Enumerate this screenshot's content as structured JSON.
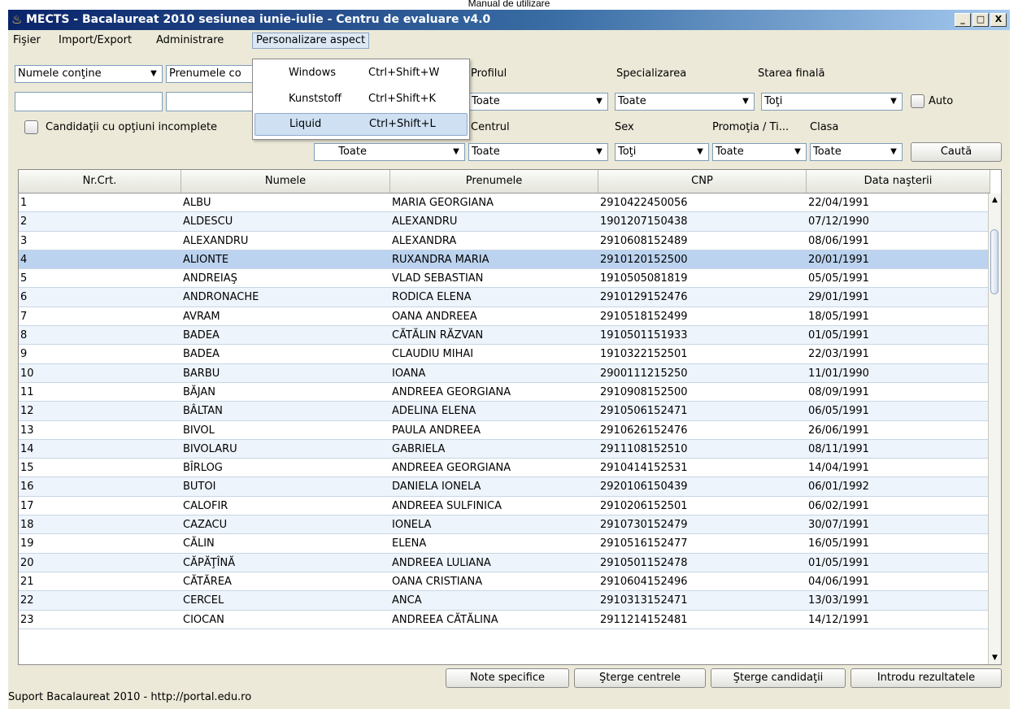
{
  "page_caption": "Manual de utilizare",
  "window": {
    "title": "MECTS - Bacalaureat 2010 sesiunea iunie-iulie - Centru de evaluare v4.0",
    "minimize": "_",
    "maximize": "□",
    "close": "X"
  },
  "menu": {
    "items": [
      {
        "label": "Fişier"
      },
      {
        "label": "Import/Export"
      },
      {
        "label": "Administrare"
      },
      {
        "label": "Personalizare aspect"
      }
    ],
    "popup": [
      {
        "label": "Windows",
        "shortcut": "Ctrl+Shift+W"
      },
      {
        "label": "Kunststoff",
        "shortcut": "Ctrl+Shift+K"
      },
      {
        "label": "Liquid",
        "shortcut": "Ctrl+Shift+L"
      }
    ]
  },
  "filters": {
    "name_mode": "Numele conţine",
    "firstname_mode": "Prenumele co",
    "profile_label": "Profilul",
    "profile_value": "Toate",
    "spec_label": "Specializarea",
    "spec_value": "Toate",
    "final_label": "Starea finală",
    "final_value": "Toţi",
    "auto_label": "Auto",
    "incomplete_label": "Candidaţii cu opţiuni incomplete",
    "combo1_value": "Toate",
    "centre_label": "Centrul",
    "centre_value": "Toate",
    "sex_label": "Sex",
    "sex_value": "Toţi",
    "promo_label": "Promoţia / Ti...",
    "promo_value": "Toate",
    "class_label": "Clasa",
    "class_value": "Toate",
    "search_button": "Caută"
  },
  "table": {
    "columns": [
      "Nr.Crt.",
      "Numele",
      "Prenumele",
      "CNP",
      "Data naşterii"
    ],
    "selected_row": 3,
    "rows": [
      [
        "1",
        "ALBU",
        "MARIA GEORGIANA",
        "2910422450056",
        "22/04/1991"
      ],
      [
        "2",
        "ALDESCU",
        "ALEXANDRU",
        "1901207150438",
        "07/12/1990"
      ],
      [
        "3",
        "ALEXANDRU",
        "ALEXANDRA",
        "2910608152489",
        "08/06/1991"
      ],
      [
        "4",
        "ALIONTE",
        "RUXANDRA MARIA",
        "2910120152500",
        "20/01/1991"
      ],
      [
        "5",
        "ANDREIAŞ",
        "VLAD SEBASTIAN",
        "1910505081819",
        "05/05/1991"
      ],
      [
        "6",
        "ANDRONACHE",
        "RODICA ELENA",
        "2910129152476",
        "29/01/1991"
      ],
      [
        "7",
        "AVRAM",
        "OANA ANDREEA",
        "2910518152499",
        "18/05/1991"
      ],
      [
        "8",
        "BADEA",
        "CĂTĂLIN RĂZVAN",
        "1910501151933",
        "01/05/1991"
      ],
      [
        "9",
        "BADEA",
        "CLAUDIU MIHAI",
        "1910322152501",
        "22/03/1991"
      ],
      [
        "10",
        "BARBU",
        "IOANA",
        "2900111215250",
        "11/01/1990"
      ],
      [
        "11",
        "BĂJAN",
        "ANDREEA GEORGIANA",
        "2910908152500",
        "08/09/1991"
      ],
      [
        "12",
        "BÂLTAN",
        "ADELINA ELENA",
        "2910506152471",
        "06/05/1991"
      ],
      [
        "13",
        "BIVOL",
        "PAULA ANDREEA",
        "2910626152476",
        "26/06/1991"
      ],
      [
        "14",
        "BIVOLARU",
        "GABRIELA",
        "2911108152510",
        "08/11/1991"
      ],
      [
        "15",
        "BÎRLOG",
        "ANDREEA GEORGIANA",
        "2910414152531",
        "14/04/1991"
      ],
      [
        "16",
        "BUTOI",
        "DANIELA IONELA",
        "2920106150439",
        "06/01/1992"
      ],
      [
        "17",
        "CALOFIR",
        "ANDREEA SULFINICA",
        "2910206152501",
        "06/02/1991"
      ],
      [
        "18",
        "CAZACU",
        "IONELA",
        "2910730152479",
        "30/07/1991"
      ],
      [
        "19",
        "CĂLIN",
        "ELENA",
        "2910516152477",
        "16/05/1991"
      ],
      [
        "20",
        "CĂPĂŢÎNĂ",
        "ANDREEA LULIANA",
        "2910501152478",
        "01/05/1991"
      ],
      [
        "21",
        "CĂTĂREA",
        "OANA CRISTIANA",
        "2910604152496",
        "04/06/1991"
      ],
      [
        "22",
        "CERCEL",
        "ANCA",
        "2910313152471",
        "13/03/1991"
      ],
      [
        "23",
        "CIOCAN",
        "ANDREEA CĂTĂLINA",
        "2911214152481",
        "14/12/1991"
      ]
    ]
  },
  "actions": {
    "notes": "Note specifice",
    "delete_centres": "Şterge centrele",
    "delete_candidates": "Şterge candidaţii",
    "enter_results": "Introdu rezultatele"
  },
  "status": "Suport Bacalaureat 2010 - http://portal.edu.ro"
}
